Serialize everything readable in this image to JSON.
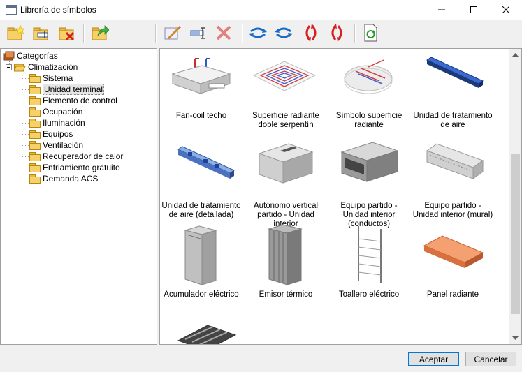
{
  "window": {
    "title": "Librería de símbolos"
  },
  "tree": {
    "root": "Categorías",
    "group": "Climatización",
    "items": [
      "Sistema",
      "Unidad terminal",
      "Elemento de control",
      "Ocupación",
      "Iluminación",
      "Equipos",
      "Ventilación",
      "Recuperador de calor",
      "Enfriamiento gratuito",
      "Demanda ACS"
    ],
    "selected": "Unidad terminal"
  },
  "symbols": [
    {
      "label": "Fan-coil techo"
    },
    {
      "label": "Superficie radiante doble serpentín"
    },
    {
      "label": "Símbolo superficie radiante"
    },
    {
      "label": "Unidad de tratamiento de aire"
    },
    {
      "label": "Unidad de tratamiento de aire (detallada)"
    },
    {
      "label": "Autónomo vertical partido - Unidad interior"
    },
    {
      "label": "Equipo partido - Unidad interior (conductos)"
    },
    {
      "label": "Equipo partido - Unidad interior (mural)"
    },
    {
      "label": "Acumulador eléctrico"
    },
    {
      "label": "Emisor térmico"
    },
    {
      "label": "Toallero eléctrico"
    },
    {
      "label": "Panel radiante"
    }
  ],
  "buttons": {
    "accept": "Aceptar",
    "cancel": "Cancelar"
  },
  "toolbar_icons": [
    "new-folder-icon",
    "rename-folder-icon",
    "delete-folder-icon",
    "import-icon",
    "edit-symbol-icon",
    "rename-symbol-icon",
    "delete-symbol-icon",
    "rotate-horizontal-icon",
    "rotate-horizontal-reverse-icon",
    "rotate-vertical-icon",
    "rotate-vertical-reverse-icon",
    "refresh-document-icon"
  ]
}
